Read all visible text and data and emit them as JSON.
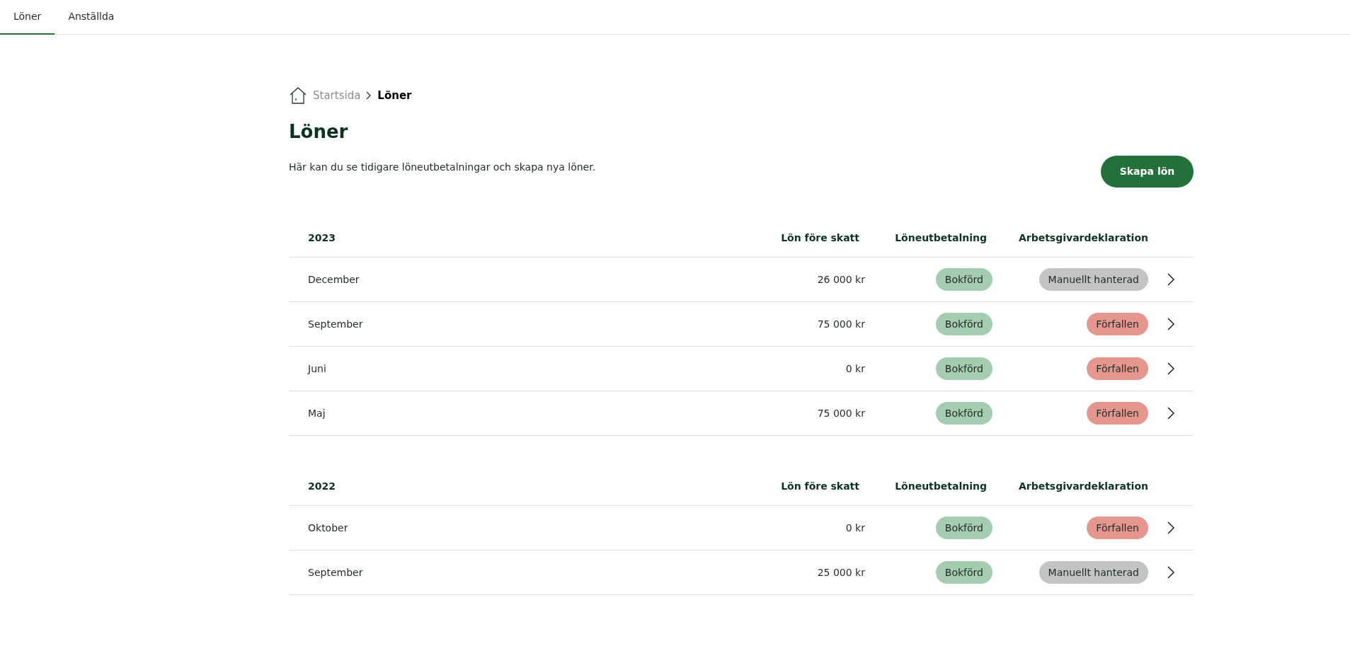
{
  "tabs": [
    {
      "label": "Löner",
      "selected": true
    },
    {
      "label": "Anställda",
      "selected": false
    }
  ],
  "breadcrumb": {
    "home": "Startsida",
    "current": "Löner"
  },
  "title": "Löner",
  "description": "Här kan du se tidigare löneutbetalningar och skapa nya löner.",
  "create_button": "Skapa lön",
  "groups": [
    {
      "year": "2023",
      "columns": [
        "Lön före skatt",
        "Löneutbetalning",
        "Arbetsgivardeklaration"
      ],
      "rows": [
        {
          "month": "December",
          "amount": "26 000 kr",
          "payment": {
            "label": "Bokförd",
            "color": "#a5cbb0"
          },
          "declaration": {
            "label": "Manuellt hanterad",
            "color": "#c2c5c3"
          }
        },
        {
          "month": "September",
          "amount": "75 000 kr",
          "payment": {
            "label": "Bokförd",
            "color": "#a5cbb0"
          },
          "declaration": {
            "label": "Förfallen",
            "color": "#e4968f"
          }
        },
        {
          "month": "Juni",
          "amount": "0 kr",
          "payment": {
            "label": "Bokförd",
            "color": "#a5cbb0"
          },
          "declaration": {
            "label": "Förfallen",
            "color": "#e4968f"
          }
        },
        {
          "month": "Maj",
          "amount": "75 000 kr",
          "payment": {
            "label": "Bokförd",
            "color": "#a5cbb0"
          },
          "declaration": {
            "label": "Förfallen",
            "color": "#e4968f"
          }
        }
      ]
    },
    {
      "year": "2022",
      "columns": [
        "Lön före skatt",
        "Löneutbetalning",
        "Arbetsgivardeklaration"
      ],
      "rows": [
        {
          "month": "Oktober",
          "amount": "0 kr",
          "payment": {
            "label": "Bokförd",
            "color": "#a5cbb0"
          },
          "declaration": {
            "label": "Förfallen",
            "color": "#e4968f"
          }
        },
        {
          "month": "September",
          "amount": "25 000 kr",
          "payment": {
            "label": "Bokförd",
            "color": "#a5cbb0"
          },
          "declaration": {
            "label": "Manuellt hanterad",
            "color": "#c2c5c3"
          }
        }
      ]
    }
  ]
}
